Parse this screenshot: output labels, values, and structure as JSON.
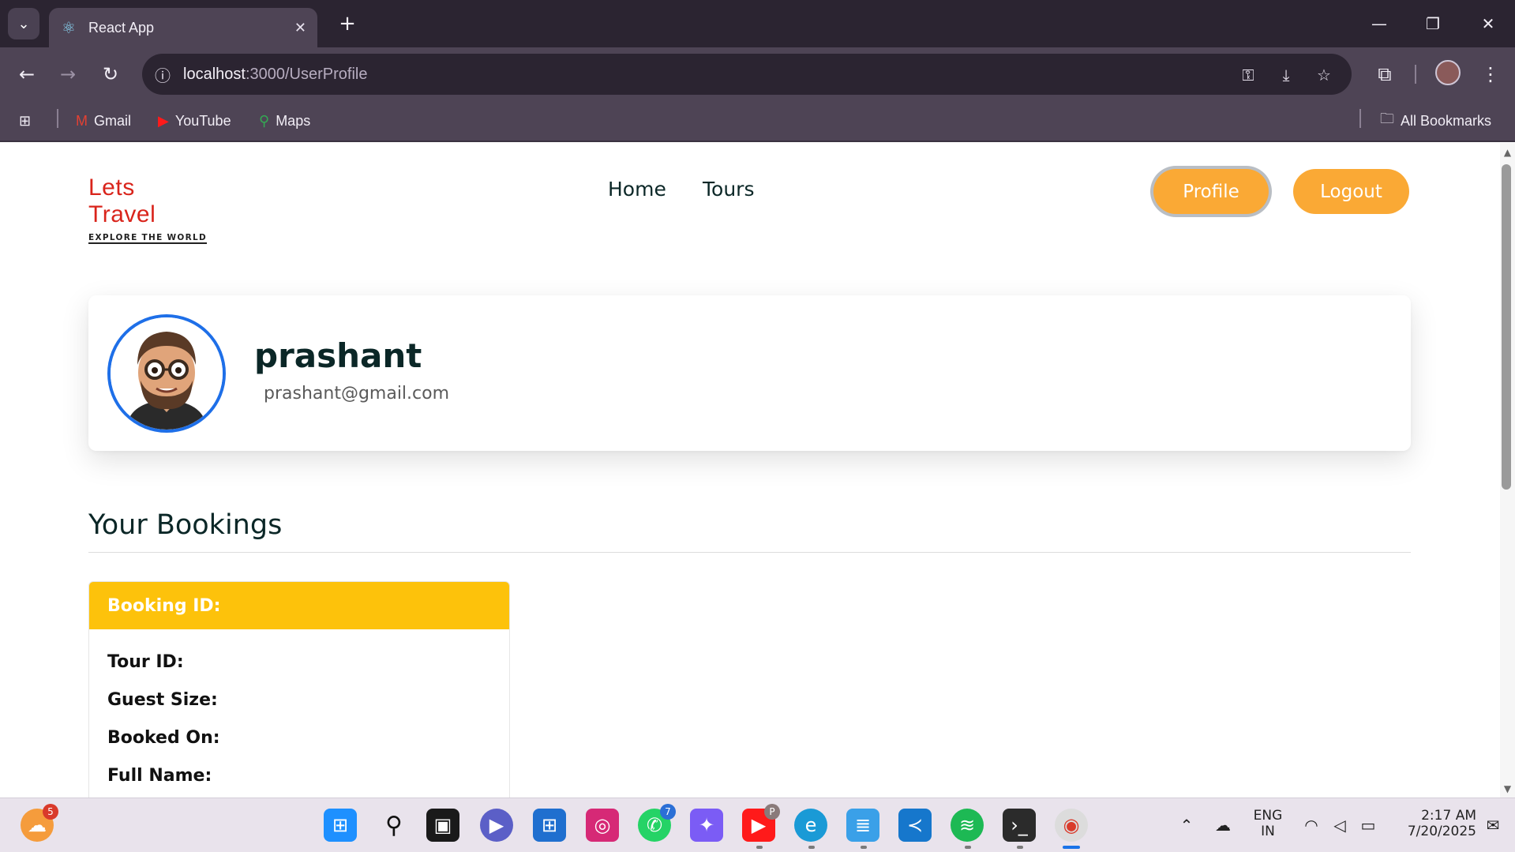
{
  "browser": {
    "tab_title": "React App",
    "url_host": "localhost",
    "url_rest": ":3000/UserProfile",
    "bookmarks": [
      {
        "label": "Gmail",
        "icon": "gmail-icon"
      },
      {
        "label": "YouTube",
        "icon": "youtube-icon"
      },
      {
        "label": "Maps",
        "icon": "maps-icon"
      }
    ],
    "all_bookmarks": "All Bookmarks"
  },
  "site": {
    "logo_text": "Lets Travel",
    "logo_tagline": "EXPLORE THE WORLD",
    "nav": [
      "Home",
      "Tours"
    ],
    "profile_button": "Profile",
    "logout_button": "Logout",
    "accent_color": "#faa935"
  },
  "profile": {
    "name": "prashant",
    "email": "prashant@gmail.com"
  },
  "bookings": {
    "title": "Your Bookings",
    "card": {
      "header": "Booking ID:",
      "fields": [
        "Tour ID:",
        "Guest Size:",
        "Booked On:",
        "Full Name:"
      ],
      "header_color": "#fdc20b"
    }
  },
  "taskbar": {
    "weather_badge": "5",
    "whatsapp_badge": "7",
    "youtube_badge": "P",
    "lang_top": "ENG",
    "lang_bottom": "IN",
    "time": "2:17 AM",
    "date": "7/20/2025"
  }
}
